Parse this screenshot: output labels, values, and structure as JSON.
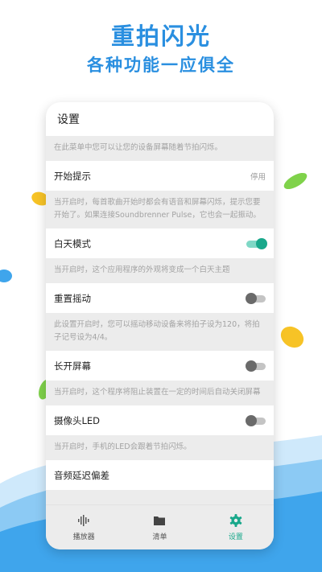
{
  "promo": {
    "headline": "重拍闪光",
    "subheadline": "各种功能一应俱全"
  },
  "settings": {
    "title": "设置",
    "intro": "在此菜单中您可以让您的设备屏幕随着节拍闪烁。",
    "items": [
      {
        "label": "开始提示",
        "value": "停用",
        "desc": "当开启时，每首歌曲开始时都会有语音和屏幕闪烁，提示您要开始了。如果连接Soundbrenner Pulse，它也会一起振动。"
      },
      {
        "label": "白天模式",
        "toggle": true,
        "desc": "当开启时，这个应用程序的外观将变成一个白天主题"
      },
      {
        "label": "重置摇动",
        "toggle": false,
        "desc": "此设置开启时，您可以摇动移动设备来将拍子设为120，将拍子记号设为4/4。"
      },
      {
        "label": "长开屏幕",
        "toggle": false,
        "desc": "当开启时，这个程序将阻止装置在一定的时间后自动关闭屏幕"
      },
      {
        "label": "摄像头LED",
        "toggle": false,
        "desc": "当开启时，手机的LED会跟着节拍闪烁。"
      },
      {
        "label": "音频延迟偏差"
      }
    ]
  },
  "tabs": [
    {
      "label": "播放器",
      "icon": "waveform-icon",
      "active": false
    },
    {
      "label": "清单",
      "icon": "folder-icon",
      "active": false
    },
    {
      "label": "设置",
      "icon": "gear-icon",
      "active": true
    }
  ],
  "colors": {
    "accent": "#19a88b",
    "headline": "#2a8fe0"
  }
}
